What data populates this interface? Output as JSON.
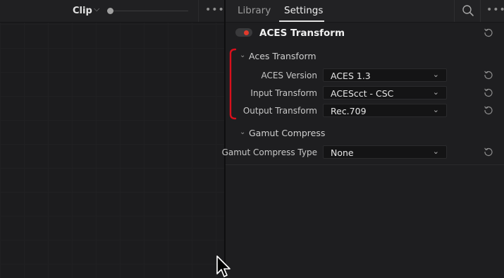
{
  "left_panel": {
    "title": "Clip",
    "chevron": "⌵",
    "more": "•••"
  },
  "right_panel": {
    "tabs": [
      {
        "label": "Library",
        "active": false
      },
      {
        "label": "Settings",
        "active": true
      }
    ],
    "more": "•••",
    "effect": {
      "title": "ACES Transform",
      "enabled": true
    },
    "groups": [
      {
        "title": "Aces Transform",
        "expanded": true,
        "rows": [
          {
            "label": "ACES Version",
            "value": "ACES 1.3"
          },
          {
            "label": "Input Transform",
            "value": "ACEScct - CSC"
          },
          {
            "label": "Output Transform",
            "value": "Rec.709"
          }
        ]
      },
      {
        "title": "Gamut Compress",
        "expanded": true,
        "rows": [
          {
            "label": "Gamut Compress Type",
            "value": "None"
          }
        ]
      }
    ]
  },
  "icons": {
    "search": "search-icon",
    "reset": "reset-icon",
    "dropdown": "chevron-down-icon",
    "group_toggle": "chevron-down-icon"
  },
  "colors": {
    "background": "#1c1c1e",
    "panel": "#1e1e20",
    "toggle_on": "#e23a2c",
    "annotation": "#d8101c",
    "text": "#cfcfcf"
  }
}
